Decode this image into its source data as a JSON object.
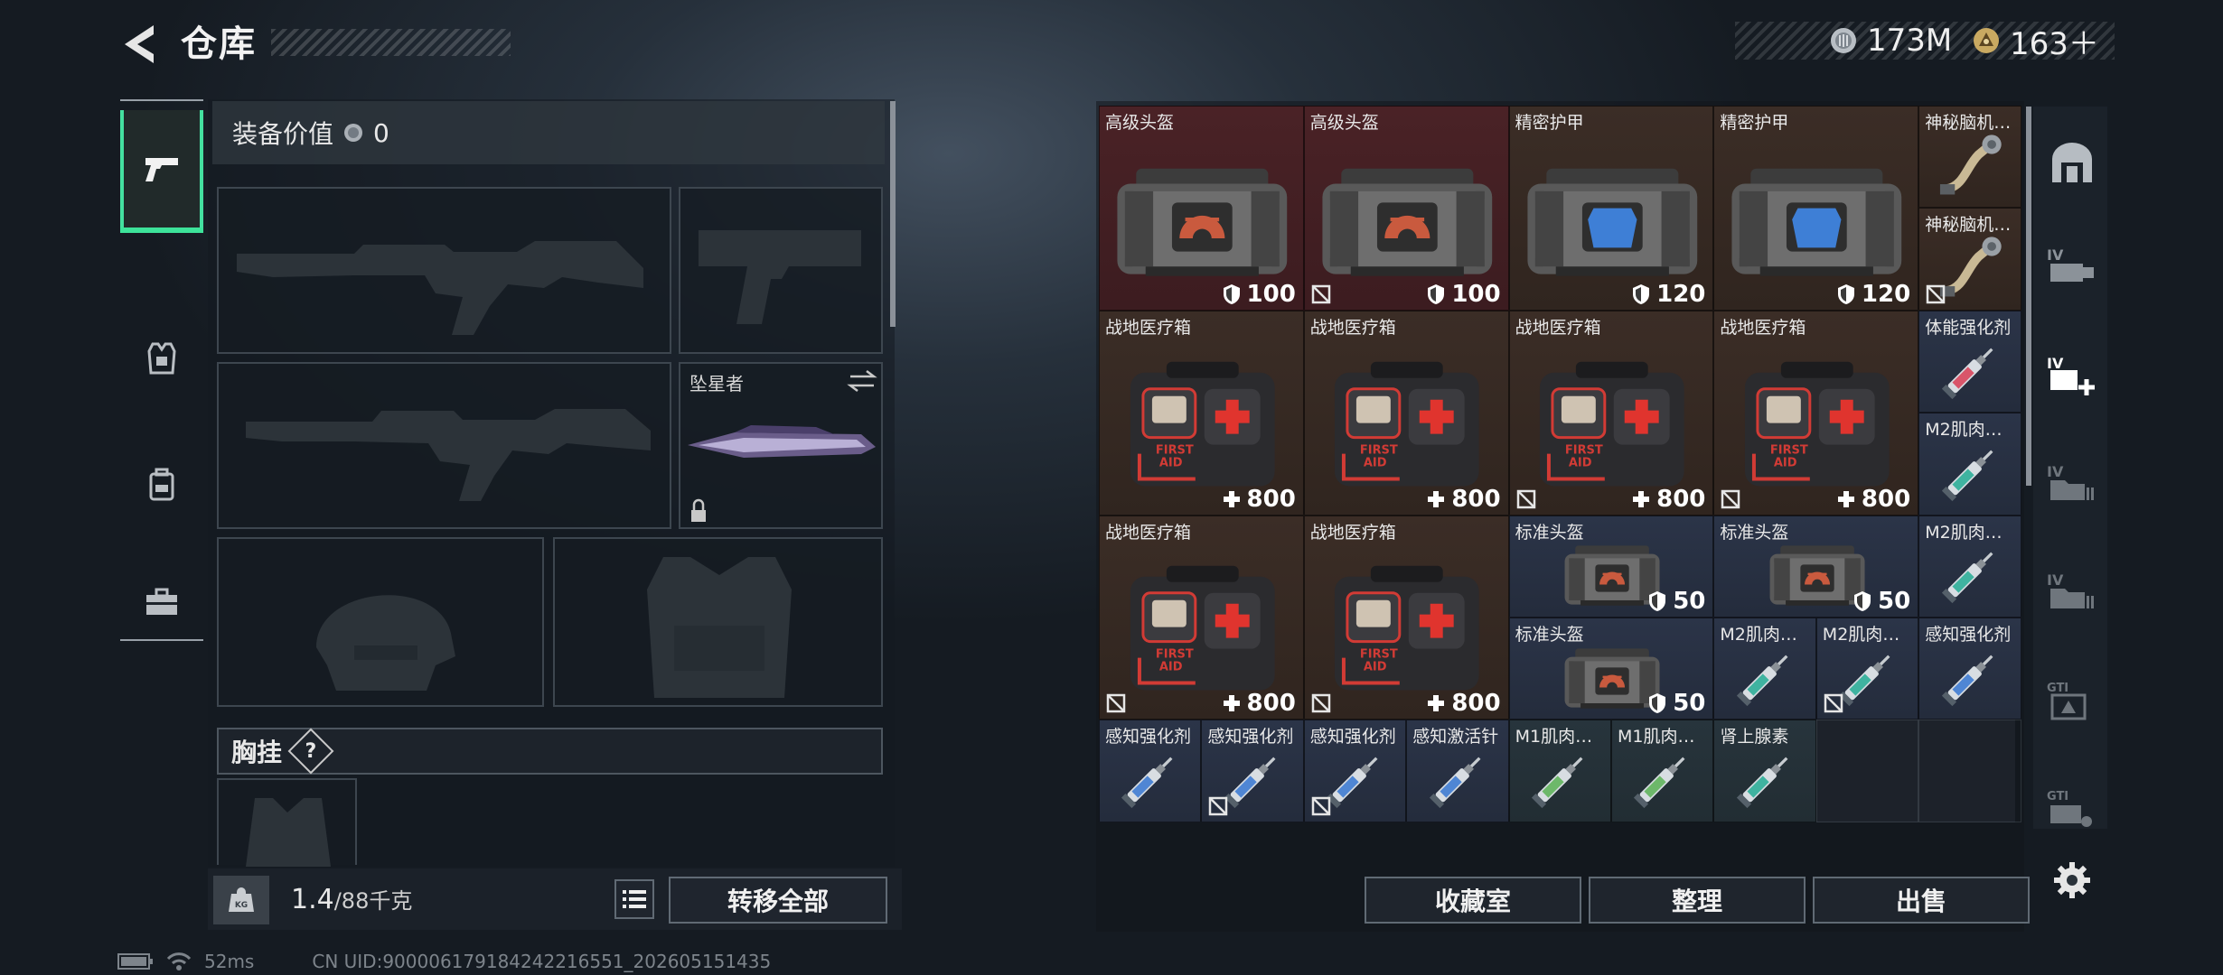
{
  "header": {
    "title": "仓库",
    "currency_silver": "173M",
    "currency_gold": "163＋"
  },
  "equip": {
    "value_label": "装备价值",
    "value": "0",
    "melee_name": "坠星者",
    "chest_label": "胸挂",
    "help": "?"
  },
  "bottom_left": {
    "weight": "1.4",
    "weight_max": "/88千克",
    "transfer_all": "转移全部"
  },
  "storage_buttons": {
    "collection": "收藏室",
    "sort": "整理",
    "sell": "出售"
  },
  "items": [
    {
      "name": "高级头盔",
      "value": "100",
      "type": "bag-red",
      "rarity": "red",
      "lock": false
    },
    {
      "name": "高级头盔",
      "value": "100",
      "type": "bag-red",
      "rarity": "red",
      "lock": true
    },
    {
      "name": "精密护甲",
      "value": "120",
      "type": "bag-blue",
      "rarity": "brown",
      "lock": false
    },
    {
      "name": "精密护甲",
      "value": "120",
      "type": "bag-blue",
      "rarity": "brown",
      "lock": false
    },
    {
      "name": "神秘脑机…",
      "value": "",
      "type": "cable",
      "rarity": "brown",
      "lock": false
    },
    {
      "name": "神秘脑机…",
      "value": "",
      "type": "cable",
      "rarity": "brown",
      "lock": true
    },
    {
      "name": "战地医疗箱",
      "value": "800",
      "type": "medkit",
      "rarity": "brown",
      "lock": false
    },
    {
      "name": "战地医疗箱",
      "value": "800",
      "type": "medkit",
      "rarity": "brown",
      "lock": false
    },
    {
      "name": "战地医疗箱",
      "value": "800",
      "type": "medkit",
      "rarity": "brown",
      "lock": true
    },
    {
      "name": "战地医疗箱",
      "value": "800",
      "type": "medkit",
      "rarity": "brown",
      "lock": true
    },
    {
      "name": "体能强化剂",
      "value": "",
      "type": "syringe-red",
      "rarity": "blue",
      "lock": false
    },
    {
      "name": "M2肌肉…",
      "value": "",
      "type": "syringe-teal",
      "rarity": "blue",
      "lock": false
    },
    {
      "name": "战地医疗箱",
      "value": "800",
      "type": "medkit",
      "rarity": "brown",
      "lock": true
    },
    {
      "name": "战地医疗箱",
      "value": "800",
      "type": "medkit",
      "rarity": "brown",
      "lock": true
    },
    {
      "name": "标准头盔",
      "value": "50",
      "type": "bag-small",
      "rarity": "blue",
      "lock": false
    },
    {
      "name": "标准头盔",
      "value": "50",
      "type": "bag-small",
      "rarity": "blue",
      "lock": false
    },
    {
      "name": "M2肌肉…",
      "value": "",
      "type": "syringe-teal",
      "rarity": "blue",
      "lock": false
    },
    {
      "name": "标准头盔",
      "value": "50",
      "type": "bag-small",
      "rarity": "blue",
      "lock": false
    },
    {
      "name": "M2肌肉…",
      "value": "",
      "type": "syringe-teal",
      "rarity": "blue",
      "lock": false
    },
    {
      "name": "M2肌肉…",
      "value": "",
      "type": "syringe-teal",
      "rarity": "blue",
      "lock": true
    },
    {
      "name": "感知强化剂",
      "value": "",
      "type": "syringe-blue",
      "rarity": "blue",
      "lock": false
    },
    {
      "name": "感知强化剂",
      "value": "",
      "type": "syringe-blue",
      "rarity": "blue",
      "lock": false
    },
    {
      "name": "感知强化剂",
      "value": "",
      "type": "syringe-blue",
      "rarity": "blue",
      "lock": true
    },
    {
      "name": "感知强化剂",
      "value": "",
      "type": "syringe-blue",
      "rarity": "blue",
      "lock": true
    },
    {
      "name": "感知激活针",
      "value": "",
      "type": "syringe-blue",
      "rarity": "blue",
      "lock": false
    },
    {
      "name": "M1肌肉…",
      "value": "",
      "type": "syringe-green",
      "rarity": "teal",
      "lock": false
    },
    {
      "name": "M1肌肉…",
      "value": "",
      "type": "syringe-green",
      "rarity": "teal",
      "lock": false
    },
    {
      "name": "肾上腺素",
      "value": "",
      "type": "syringe-teal",
      "rarity": "teal",
      "lock": false
    }
  ],
  "status": {
    "ping": "52ms",
    "uid": "CN UID:9000061791842422165​51_20260515​1435"
  },
  "colors": {
    "accent_green": "#3de39a",
    "rarity_red": "#4a2226",
    "rarity_brown": "#3b2d26",
    "rarity_blue": "#2b3448",
    "rarity_teal": "#27343c"
  }
}
